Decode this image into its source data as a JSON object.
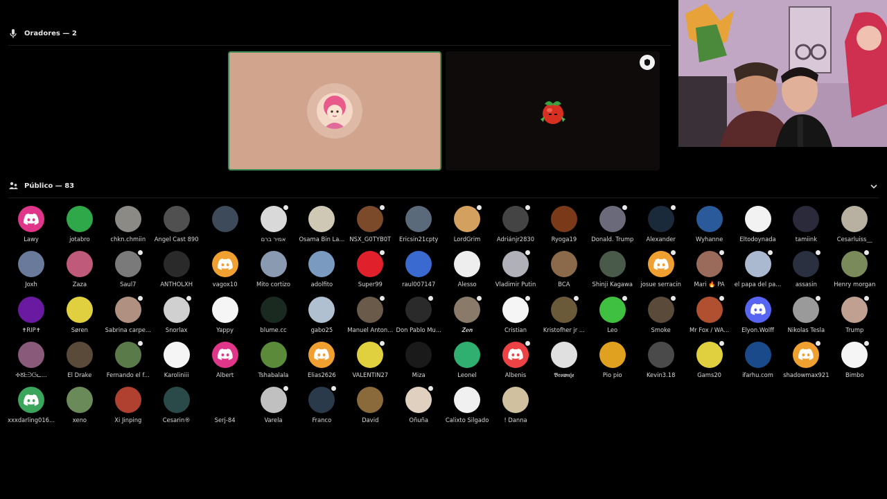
{
  "speakers_section": {
    "title": "Oradores — 2",
    "icon": "microphone-icon"
  },
  "audience_section": {
    "title": "Público — 83",
    "icon": "audience-icon",
    "toggle_icon": "chevron-down-icon"
  },
  "colors": {
    "background": "#000000",
    "speaker_tile_active": "#d1a48e",
    "speaking_ring": "#3f8a55",
    "speaker_tile_dark": "#0f0b0b",
    "discord_pink": "#e0368a",
    "discord_orange": "#f0a030",
    "discord_green": "#3ba55c",
    "discord_blurple": "#5865f2",
    "discord_red": "#ed4245"
  },
  "speakers": [
    {
      "name": "speaker-1",
      "avatar_icon": "anime-girl-avatar",
      "speaking": true
    },
    {
      "name": "speaker-2",
      "avatar_icon": "tomato-avatar",
      "speaking": false,
      "badge_icon": "stage-badge-icon"
    }
  ],
  "video_feed": {
    "icon": "camera-feed"
  },
  "audience": [
    {
      "label": "Lawy",
      "bg": "#e0368a",
      "discord": true
    },
    {
      "label": "jotabro",
      "bg": "#2fa84a"
    },
    {
      "label": "chkn.chmiin",
      "bg": "#8c8a85"
    },
    {
      "label": "Angel Cast 890",
      "bg": "#505050"
    },
    {
      "label": "",
      "bg": "#3c4a5a"
    },
    {
      "label": "אמיר ברם",
      "bg": "#d9d9d9",
      "badge": true
    },
    {
      "label": "Osama Bin La...",
      "bg": "#cfc8b5"
    },
    {
      "label": "NSX_G0TYB0T",
      "bg": "#7a4a2a",
      "badge": true
    },
    {
      "label": "Ericsin21cpty",
      "bg": "#5a6a7a"
    },
    {
      "label": "LordGrim",
      "bg": "#d4a060",
      "badge": true
    },
    {
      "label": "Adriánjr2830",
      "bg": "#444444",
      "badge": true
    },
    {
      "label": "Ryoga19",
      "bg": "#7a3a1a"
    },
    {
      "label": "Donald. Trump",
      "bg": "#6a6a7a",
      "badge": true
    },
    {
      "label": "Alexander",
      "bg": "#1a2a3a",
      "badge": true
    },
    {
      "label": "Wyhanne",
      "bg": "#2a5a9a"
    },
    {
      "label": "Eltodoynada",
      "bg": "#f2f2f2"
    },
    {
      "label": "tamiink",
      "bg": "#2a2a3a"
    },
    {
      "label": "Cesarluiss__",
      "bg": "#b8b0a0"
    },
    {
      "label": "Joxh",
      "bg": "#6a7a9a"
    },
    {
      "label": "Zaza",
      "bg": "#c05a7a"
    },
    {
      "label": "Saul7",
      "bg": "#7a7a7a",
      "badge": true
    },
    {
      "label": "ANTHOLXH",
      "bg": "#2a2a2a"
    },
    {
      "label": "vagox10",
      "bg": "#f0a030",
      "discord": true
    },
    {
      "label": "Mito cortizo",
      "bg": "#8a9ab0"
    },
    {
      "label": "adolfito",
      "bg": "#7a9ac0"
    },
    {
      "label": "Super99",
      "bg": "#e0202a",
      "badge": true
    },
    {
      "label": "raul007147",
      "bg": "#3a6ad0"
    },
    {
      "label": "Alesso",
      "bg": "#eeeeee"
    },
    {
      "label": "Vladimir Putin",
      "bg": "#b0b0b8",
      "badge": true
    },
    {
      "label": "BCA",
      "bg": "#8a6a4a"
    },
    {
      "label": "Shinji Kagawa",
      "bg": "#4a5a4a"
    },
    {
      "label": "josue serracin",
      "bg": "#f0a030",
      "badge": true,
      "discord": true
    },
    {
      "label": "Mari 🔥 PA",
      "bg": "#9a6a5a",
      "badge": true
    },
    {
      "label": "el papa del pa...",
      "bg": "#aab8d0",
      "badge": true
    },
    {
      "label": "assasin",
      "bg": "#2a3040",
      "badge": true
    },
    {
      "label": "Henry morgan",
      "bg": "#7a8a5a",
      "badge": true
    },
    {
      "label": "✝RIP✝",
      "bg": "#6a1aa0"
    },
    {
      "label": "Søren",
      "bg": "#e0d040"
    },
    {
      "label": "Sabrina carpe...",
      "bg": "#b09080",
      "badge": true
    },
    {
      "label": "Snorlax",
      "bg": "#d0d0d0",
      "badge": true
    },
    {
      "label": "Yappy",
      "bg": "#f5f5f5"
    },
    {
      "label": "blume.cc",
      "bg": "#1a2a20"
    },
    {
      "label": "gabo25",
      "bg": "#b0c0d0"
    },
    {
      "label": "Manuel Anton...",
      "bg": "#6a5a4a",
      "badge": true
    },
    {
      "label": "Don Pablo Mu...",
      "bg": "#2a2a2a",
      "badge": true
    },
    {
      "label": "𝒁𝒆𝒏",
      "bg": "#8a7a6a",
      "badge": true
    },
    {
      "label": "Cristian",
      "bg": "#f5f5f5",
      "badge": true
    },
    {
      "label": "Kristofher jr ...",
      "bg": "#6a5a3a",
      "badge": true
    },
    {
      "label": "Leo",
      "bg": "#40c040",
      "badge": true
    },
    {
      "label": "Smoke",
      "bg": "#5a4a3a",
      "badge": true
    },
    {
      "label": "Mr Fox / WA...",
      "bg": "#b05030",
      "badge": true
    },
    {
      "label": "Elyon.Wolff",
      "bg": "#5865f2",
      "discord": true
    },
    {
      "label": "Nikolas Tesla",
      "bg": "#9a9a9a",
      "badge": true
    },
    {
      "label": "Trump",
      "bg": "#c0a090",
      "badge": true
    },
    {
      "label": "✢ᘜᖶᕭᙍᓚ...",
      "bg": "#8a5a7a"
    },
    {
      "label": "El Drake",
      "bg": "#5a4a3a"
    },
    {
      "label": "Fernando el f...",
      "bg": "#5a7a4a",
      "badge": true
    },
    {
      "label": "Karoliniii",
      "bg": "#f5f5f5"
    },
    {
      "label": "Albert",
      "bg": "#e0368a",
      "discord": true
    },
    {
      "label": "Tshabalala",
      "bg": "#5a8a3a"
    },
    {
      "label": "Elias2626",
      "bg": "#f0a030",
      "discord": true
    },
    {
      "label": "VALENTIN27",
      "bg": "#e0d040",
      "badge": true
    },
    {
      "label": "Miza",
      "bg": "#1a1a1a"
    },
    {
      "label": "Leonel",
      "bg": "#30b070"
    },
    {
      "label": "Albenis",
      "bg": "#ed4245",
      "badge": true,
      "discord": true
    },
    {
      "label": "𝕭𝖗𝖔𝖜𝖓𝖏𝖊",
      "bg": "#e0e0e0"
    },
    {
      "label": "Pio pio",
      "bg": "#e0a020"
    },
    {
      "label": "Kevin3.18",
      "bg": "#4a4a4a"
    },
    {
      "label": "Gams20",
      "bg": "#e0d040",
      "badge": true
    },
    {
      "label": "ifarhu.com",
      "bg": "#1a4a8a"
    },
    {
      "label": "shadowmax921",
      "bg": "#f0a030",
      "badge": true,
      "discord": true
    },
    {
      "label": "Bimbo",
      "bg": "#f5f5f5",
      "badge": true
    },
    {
      "label": "xxxdarling016...",
      "bg": "#3ba55c",
      "discord": true
    },
    {
      "label": "xeno",
      "bg": "#6a8a5a"
    },
    {
      "label": "Xi Jinping",
      "bg": "#b04030"
    },
    {
      "label": "Cesarin®",
      "bg": "#2a4a4a"
    },
    {
      "label": "Serj-84",
      "bg": "#000000"
    },
    {
      "label": "Varela",
      "bg": "#c0c0c0",
      "badge": true
    },
    {
      "label": "Franco",
      "bg": "#2a3a4a",
      "badge": true
    },
    {
      "label": "David",
      "bg": "#8a6a3a"
    },
    {
      "label": "Oñuña",
      "bg": "#e0d0c0",
      "badge": true
    },
    {
      "label": "Calixto Silgado",
      "bg": "#f0f0f0"
    },
    {
      "label": "! Danna",
      "bg": "#d0c0a0"
    }
  ]
}
